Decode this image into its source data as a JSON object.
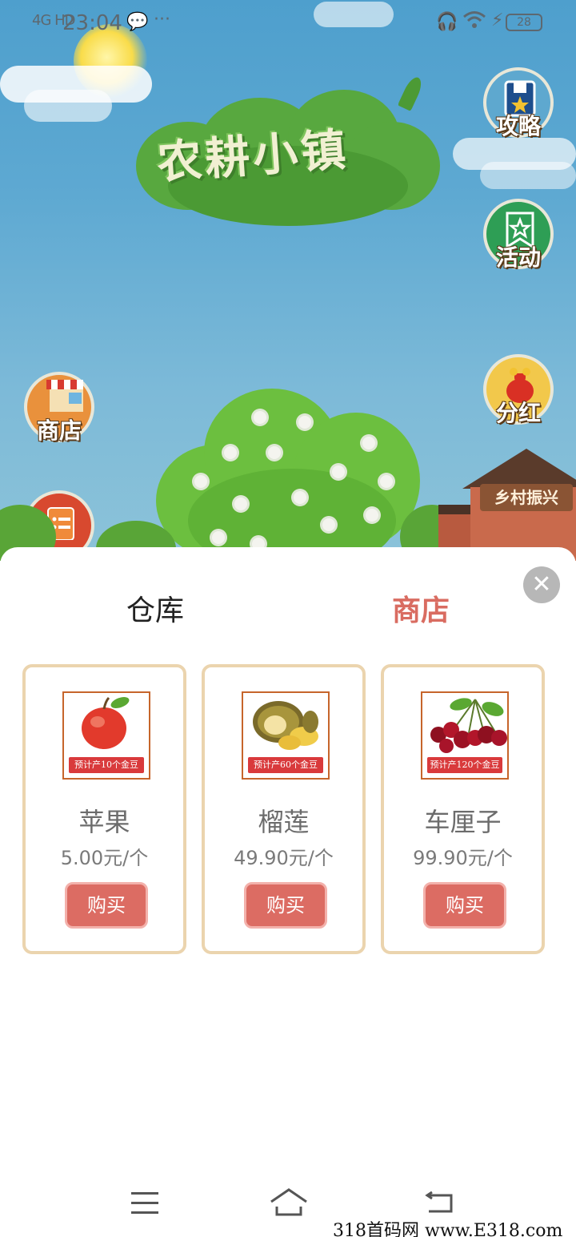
{
  "status_bar": {
    "signal": "4G HD",
    "time": "23:04",
    "battery": "28"
  },
  "game": {
    "title": "农耕小镇",
    "side_buttons": {
      "guide": "攻略",
      "activity": "活动",
      "dividend": "分红",
      "shop": "商店"
    },
    "house_sign": "乡村振兴"
  },
  "sheet": {
    "tabs": [
      {
        "label": "仓库",
        "active": false
      },
      {
        "label": "商店",
        "active": true
      }
    ],
    "close_symbol": "✕",
    "items": [
      {
        "name": "苹果",
        "price": "5.00元/个",
        "tag": "预计产10个金豆",
        "buy": "购买",
        "image": "apple"
      },
      {
        "name": "榴莲",
        "price": "49.90元/个",
        "tag": "预计产60个金豆",
        "buy": "购买",
        "image": "durian"
      },
      {
        "name": "车厘子",
        "price": "99.90元/个",
        "tag": "预计产120个金豆",
        "buy": "购买",
        "image": "cherry"
      }
    ]
  },
  "colors": {
    "active_tab": "#d96c61",
    "buy_button": "#dc6c63",
    "card_border": "#ebd4ae"
  },
  "watermark": "318首码网 www.E318.com"
}
